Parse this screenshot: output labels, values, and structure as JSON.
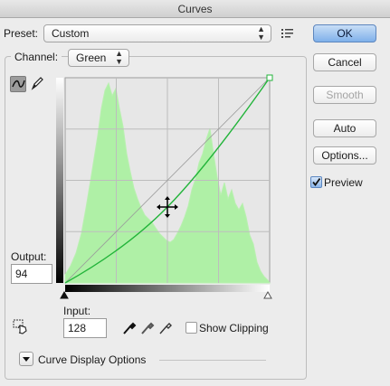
{
  "window": {
    "title": "Curves"
  },
  "preset": {
    "label": "Preset:",
    "value": "Custom"
  },
  "channel": {
    "label": "Channel:",
    "value": "Green"
  },
  "buttons": {
    "ok": "OK",
    "cancel": "Cancel",
    "smooth": "Smooth",
    "auto": "Auto",
    "options": "Options..."
  },
  "preview": {
    "label": "Preview",
    "checked": true
  },
  "output": {
    "label": "Output:",
    "value": "94"
  },
  "input": {
    "label": "Input:",
    "value": "128"
  },
  "show_clipping": {
    "label": "Show Clipping",
    "checked": false
  },
  "curve_display_options": {
    "label": "Curve Display Options"
  },
  "curve": {
    "control_point_input": 128,
    "control_point_output": 94,
    "channel_color": "#22b43a",
    "histogram_color": "#aff0a6"
  },
  "icons": {
    "preset_menu": "list-menu-icon",
    "curve_tool": "curve-tool-icon",
    "pencil_tool": "pencil-icon",
    "on_image_adjust": "hand-target-icon",
    "eyedropper_black": "black-eyedropper-icon",
    "eyedropper_gray": "gray-eyedropper-icon",
    "eyedropper_white": "white-eyedropper-icon"
  }
}
